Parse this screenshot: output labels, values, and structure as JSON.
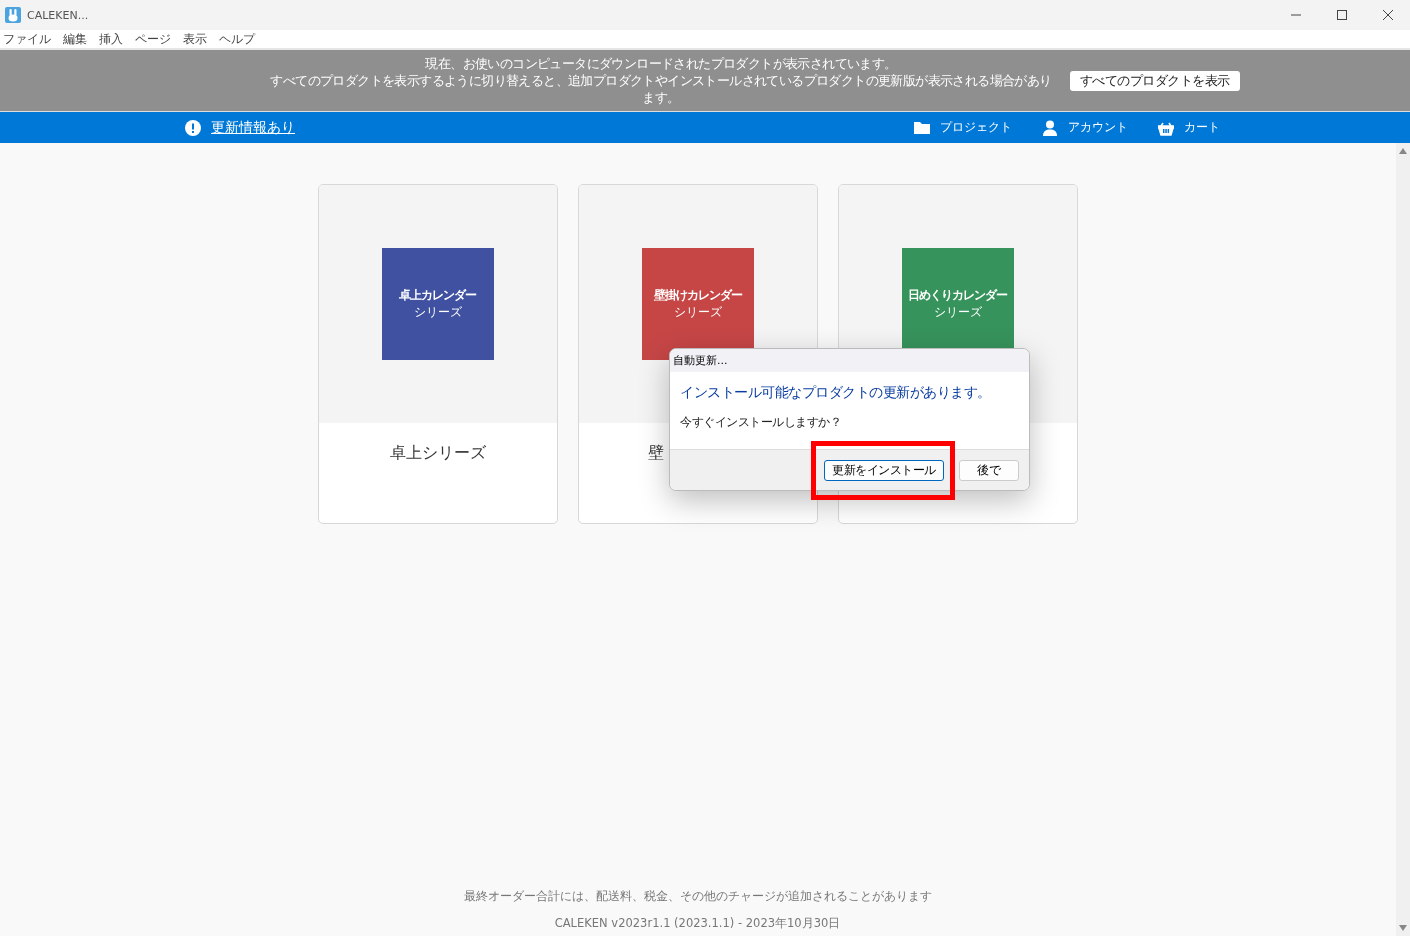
{
  "window": {
    "title": "CALEKEN..."
  },
  "menu": [
    "ファイル",
    "編集",
    "挿入",
    "ページ",
    "表示",
    "ヘルプ"
  ],
  "banner": {
    "lines": [
      "現在、お使いのコンピュータにダウンロードされたプロダクトが表示されています。",
      "すべてのプロダクトを表示するように切り替えると、追加プロダクトやインストールされているプロダクトの更新版が表示される場合があり",
      "ます。"
    ],
    "button": "すべてのプロダクトを表示"
  },
  "navbar": {
    "update_link": "更新情報あり",
    "items": [
      {
        "kind": "folder",
        "label": "プロジェクト"
      },
      {
        "kind": "person",
        "label": "アカウント"
      },
      {
        "kind": "basket",
        "label": "カート"
      }
    ]
  },
  "cards": [
    {
      "tile_title": "卓上カレンダー",
      "tile_subtitle": "シリーズ",
      "color": "#3f51a0",
      "title": "卓上シリーズ",
      "kind": "full"
    },
    {
      "tile_title": "壁掛けカレンダー",
      "tile_subtitle": "シリーズ",
      "color": "#c64646",
      "title": "壁",
      "kind": "cut"
    },
    {
      "tile_title": "日めくりカレンダー",
      "tile_subtitle": "シリーズ",
      "color": "#36935b",
      "kind": "hidden"
    }
  ],
  "dialog": {
    "title": "自動更新...",
    "heading": "インストール可能なプロダクトの更新があります。",
    "question": "今すぐインストールしますか？",
    "buttons": [
      {
        "label": "更新をインストール",
        "highlighted": true
      },
      {
        "label": "後で",
        "highlighted": false
      }
    ]
  },
  "footer": {
    "note": "最終オーダー合計には、配送料、税金、その他のチャージが追加されることがあります",
    "version": "CALEKEN v2023r1.1 (2023.1.1) - 2023年10月30日"
  }
}
